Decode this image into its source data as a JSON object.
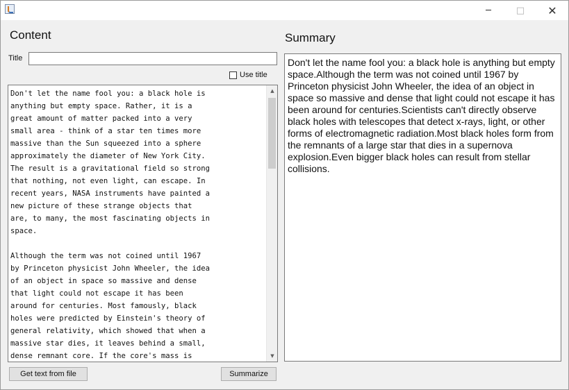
{
  "window": {
    "title": "",
    "controls": {
      "minimize": "─",
      "maximize": "□",
      "close": "✕"
    }
  },
  "content": {
    "heading": "Content",
    "title_label": "Title",
    "title_value": "",
    "use_title_label": "Use title",
    "use_title_checked": false,
    "text": "Don't let the name fool you: a black hole is\nanything but empty space. Rather, it is a\ngreat amount of matter packed into a very\nsmall area - think of a star ten times more\nmassive than the Sun squeezed into a sphere\napproximately the diameter of New York City.\nThe result is a gravitational field so strong\nthat nothing, not even light, can escape. In\nrecent years, NASA instruments have painted a\nnew picture of these strange objects that\nare, to many, the most fascinating objects in\nspace.\n\nAlthough the term was not coined until 1967\nby Princeton physicist John Wheeler, the idea\nof an object in space so massive and dense\nthat light could not escape it has been\naround for centuries. Most famously, black\nholes were predicted by Einstein's theory of\ngeneral relativity, which showed that when a\nmassive star dies, it leaves behind a small,\ndense remnant core. If the core's mass is",
    "get_text_button": "Get text from file",
    "summarize_button": "Summarize"
  },
  "summary": {
    "heading": "Summary",
    "text": "Don't let the name fool you: a black hole is anything but empty space.Although the term was not coined until 1967 by Princeton physicist John Wheeler, the idea of an object in space so massive and dense that light could not escape it has been around for centuries.Scientists can't directly observe black holes with telescopes that detect x-rays, light, or other forms of electromagnetic radiation.Most black holes form from the remnants of a large star that dies in a supernova explosion.Even bigger black holes can result from stellar collisions."
  }
}
